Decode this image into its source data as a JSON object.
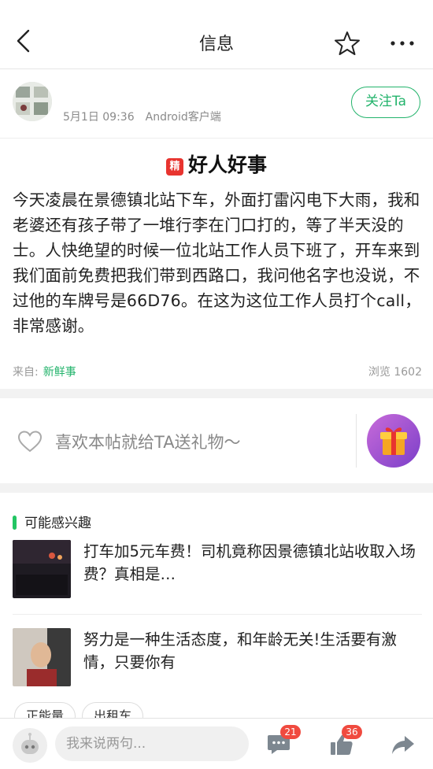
{
  "header": {
    "title": "信息",
    "icons": [
      "back-icon",
      "star-icon",
      "more-icon"
    ]
  },
  "post": {
    "date": "5月1日 09:36",
    "client": "Android客户端",
    "follow_label": "关注Ta",
    "badge": "精",
    "title": "好人好事",
    "body": "今天凌晨在景德镇北站下车，外面打雷闪电下大雨，我和老婆还有孩子带了一堆行李在门口打的，等了半天没的士。人快绝望的时候一位北站工作人员下班了，开车来到我们面前免费把我们带到西路口，我问他名字也没说，不过他的车牌号是66D76。在这为这位工作人员打个call，非常感谢。",
    "source_label": "来自:",
    "source_link": "新鲜事",
    "views": "浏览 1602"
  },
  "gift": {
    "text": "喜欢本帖就给TA送礼物～"
  },
  "related": {
    "heading": "可能感兴趣",
    "items": [
      {
        "text": "打车加5元车费！司机竟称因景德镇北站收取入场费？真相是…"
      },
      {
        "text": "努力是一种生活态度，和年龄无关!生活要有激情，只要你有"
      }
    ],
    "tags": [
      "正能量",
      "出租车"
    ]
  },
  "bottom": {
    "input_placeholder": "我来说两句...",
    "comment_count": "21",
    "like_count": "36"
  },
  "colors": {
    "accent": "#22b36b",
    "badge": "#e8342f",
    "count_badge": "#f04a3f"
  }
}
